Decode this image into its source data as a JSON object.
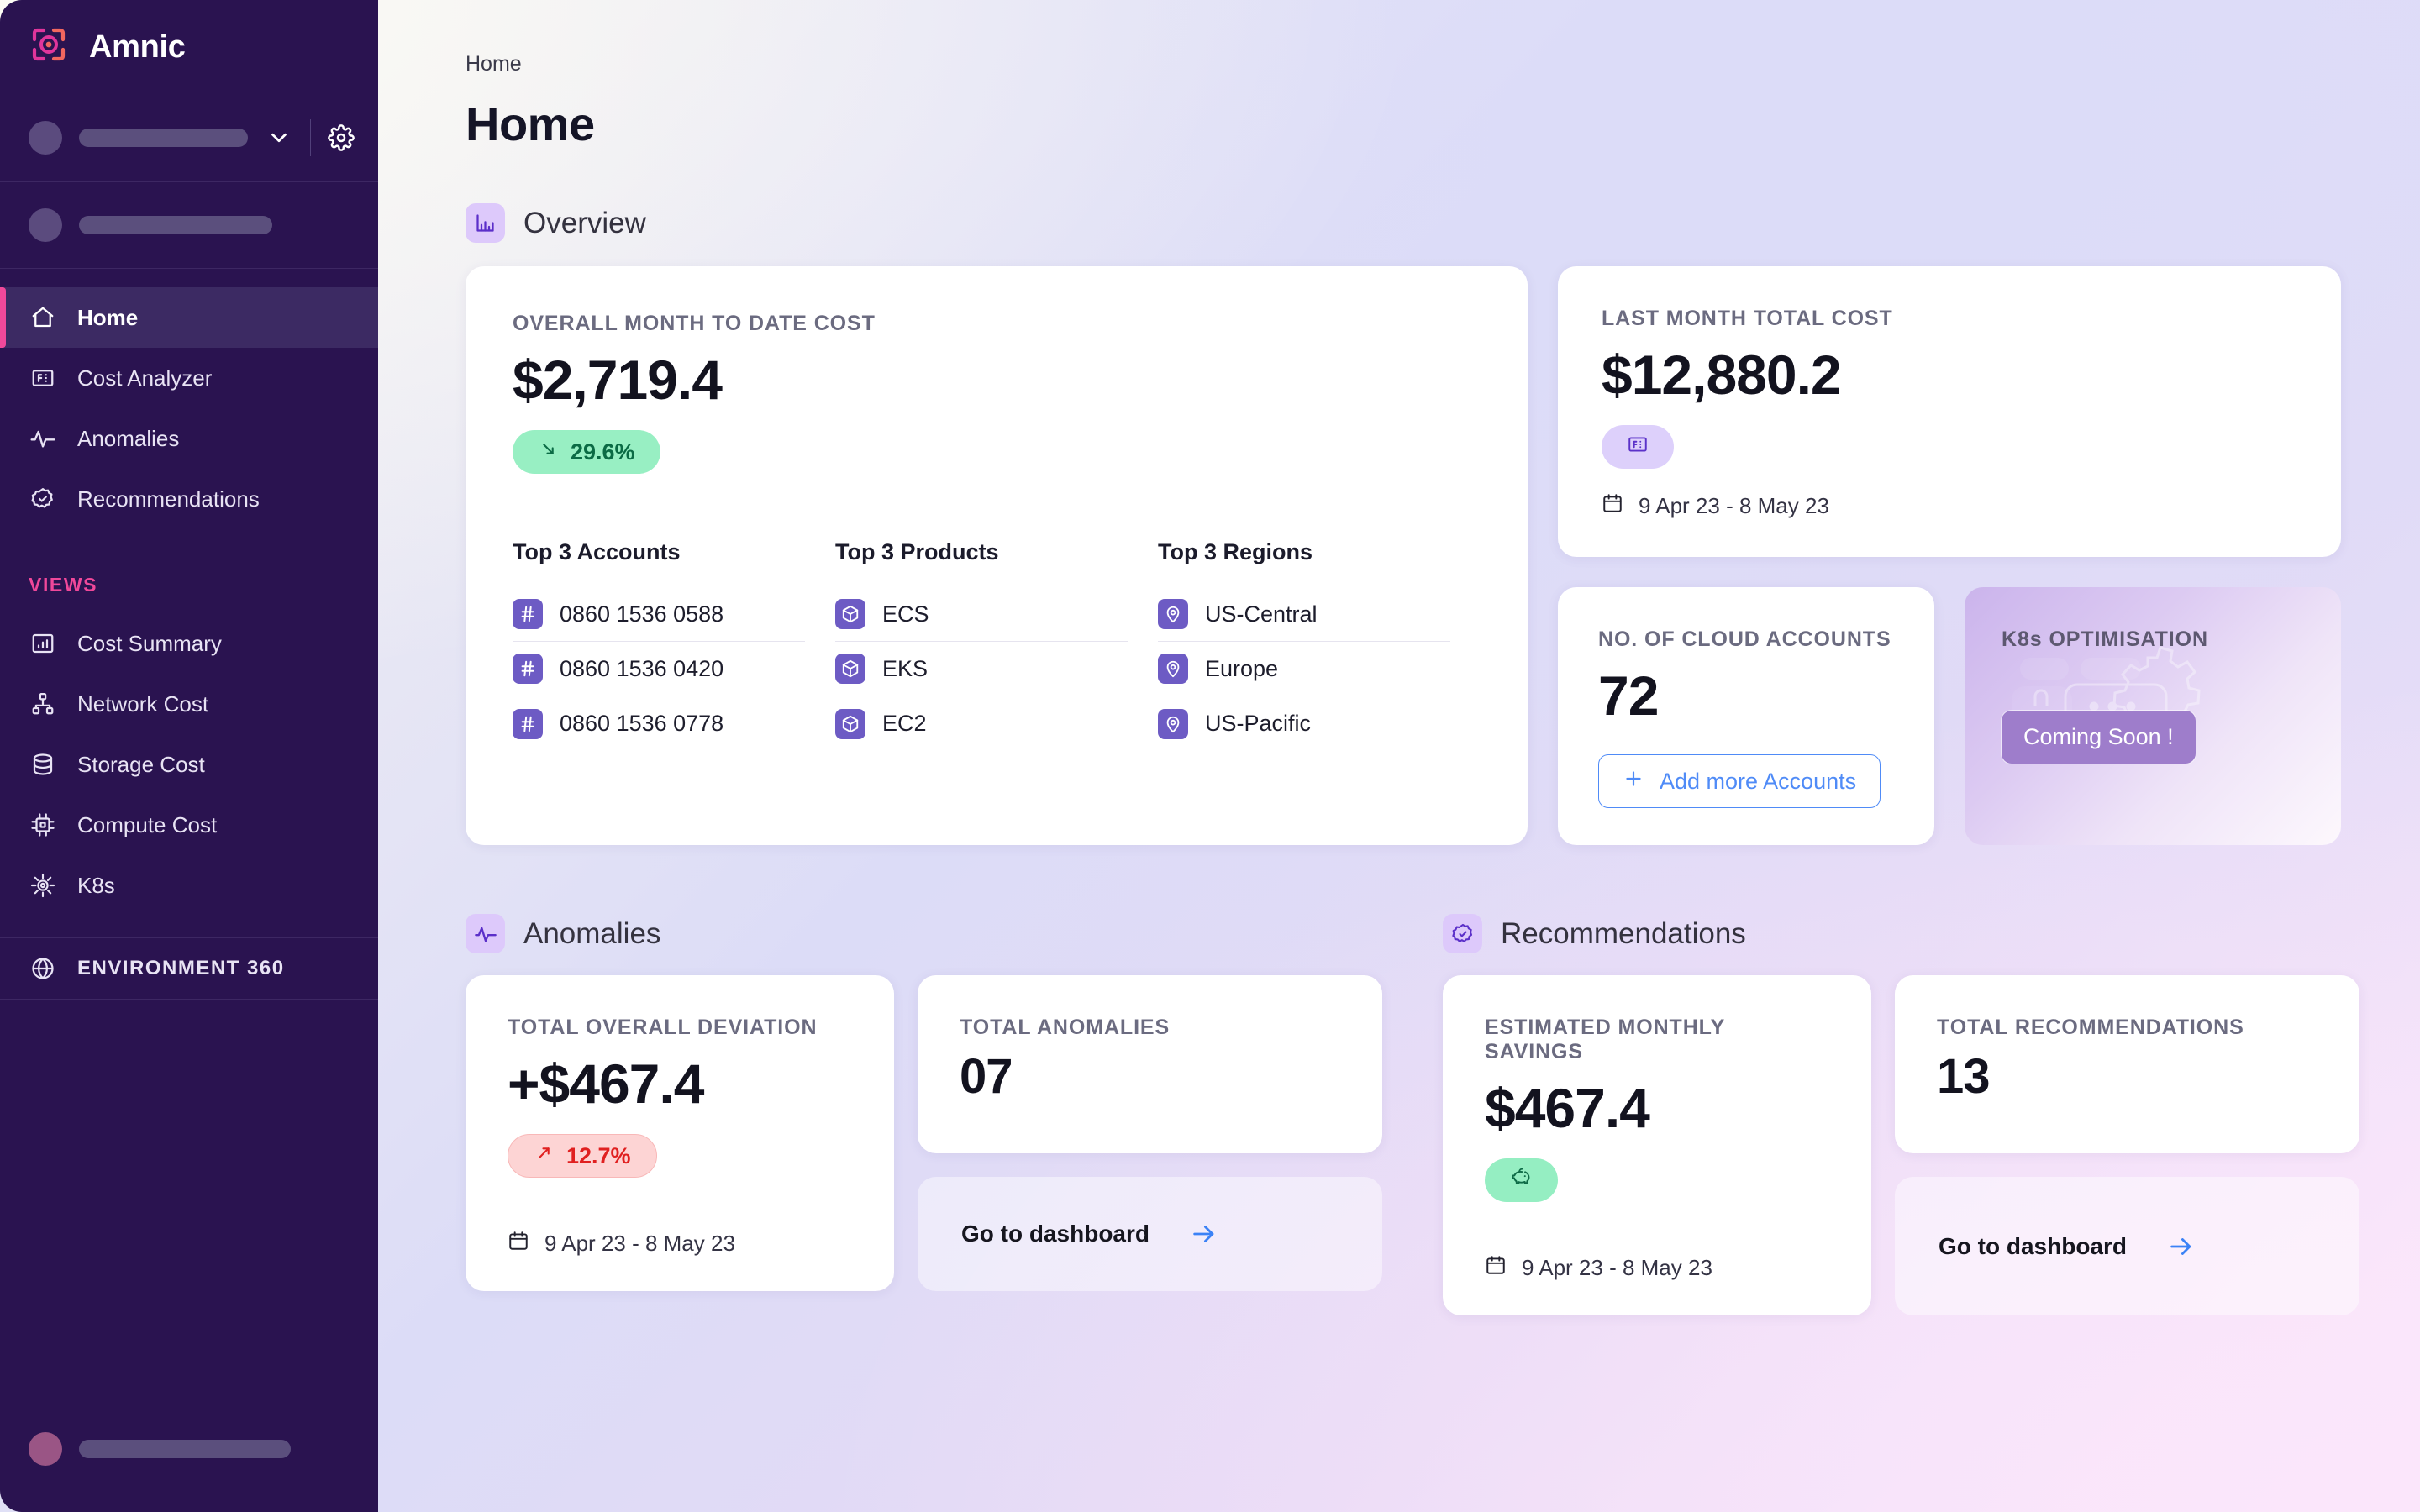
{
  "brand": {
    "name": "Amnic",
    "logo_icon": "amnic-logo-icon"
  },
  "sidebar": {
    "nav": [
      {
        "label": "Home",
        "icon": "home-icon",
        "active": true
      },
      {
        "label": "Cost Analyzer",
        "icon": "cost-analyzer-icon",
        "active": false
      },
      {
        "label": "Anomalies",
        "icon": "anomalies-pulse-icon",
        "active": false
      },
      {
        "label": "Recommendations",
        "icon": "recommendations-badge-icon",
        "active": false
      }
    ],
    "views_label": "VIEWS",
    "views": [
      {
        "label": "Cost Summary",
        "icon": "bar-chart-icon"
      },
      {
        "label": "Network Cost",
        "icon": "network-icon"
      },
      {
        "label": "Storage Cost",
        "icon": "database-icon"
      },
      {
        "label": "Compute Cost",
        "icon": "cpu-icon"
      },
      {
        "label": "K8s",
        "icon": "kubernetes-helm-icon"
      }
    ],
    "environment": {
      "label": "ENVIRONMENT 360",
      "icon": "globe-icon"
    },
    "org_switcher_icon": "chevron-down-icon",
    "settings_icon": "gear-icon"
  },
  "header": {
    "breadcrumb": "Home",
    "title": "Home"
  },
  "overview": {
    "section_title": "Overview",
    "section_icon": "bar-chart-icon",
    "mtd": {
      "label": "OVERALL MONTH TO DATE COST",
      "value": "$2,719.4",
      "delta": "29.6%",
      "delta_icon": "arrow-down-right-icon",
      "delta_color": "#0b6b45"
    },
    "top_accounts": {
      "heading": "Top 3 Accounts",
      "icon": "hash-icon",
      "items": [
        "0860 1536 0588",
        "0860 1536 0420",
        "0860 1536 0778"
      ]
    },
    "top_products": {
      "heading": "Top 3 Products",
      "icon": "cube-icon",
      "items": [
        "ECS",
        "EKS",
        "EC2"
      ]
    },
    "top_regions": {
      "heading": "Top 3 Regions",
      "icon": "map-pin-icon",
      "items": [
        "US-Central",
        "Europe",
        "US-Pacific"
      ]
    },
    "last_month": {
      "label": "LAST MONTH TOTAL COST",
      "value": "$12,880.2",
      "badge_icon": "invoice-icon",
      "date_range": "9 Apr 23 - 8 May 23",
      "date_icon": "calendar-icon"
    },
    "cloud_accounts": {
      "label": "NO. OF CLOUD ACCOUNTS",
      "value": "72",
      "button_label": "Add more Accounts",
      "button_icon": "plus-icon"
    },
    "k8s": {
      "label": "K8s OPTIMISATION",
      "badge": "Coming Soon !",
      "art_icon": "server-gear-illustration"
    }
  },
  "anomalies": {
    "section_title": "Anomalies",
    "section_icon": "anomalies-pulse-icon",
    "deviation": {
      "label": "TOTAL OVERALL DEVIATION",
      "value": "+$467.4",
      "delta": "12.7%",
      "delta_icon": "arrow-up-right-icon",
      "delta_color": "#e02020",
      "date_range": "9 Apr 23 - 8 May 23",
      "date_icon": "calendar-icon"
    },
    "total": {
      "label": "TOTAL ANOMALIES",
      "value": "07"
    },
    "dashboard_link": {
      "label": "Go to dashboard",
      "icon": "arrow-right-icon"
    }
  },
  "recommendations": {
    "section_title": "Recommendations",
    "section_icon": "recommendations-badge-icon",
    "savings": {
      "label": "ESTIMATED MONTHLY SAVINGS",
      "value": "$467.4",
      "badge_icon": "piggy-bank-icon",
      "date_range": "9 Apr 23 - 8 May 23",
      "date_icon": "calendar-icon"
    },
    "total": {
      "label": "TOTAL RECOMMENDATIONS",
      "value": "13"
    },
    "dashboard_link": {
      "label": "Go to dashboard",
      "icon": "arrow-right-icon"
    }
  },
  "colors": {
    "sidebar_bg": "#2a1350",
    "accent_pink": "#f0489a",
    "accent_violet": "#6d5bc4",
    "link_blue": "#4f8bf7",
    "positive_green": "#98efc3",
    "negative_red": "#fdd4d4"
  }
}
